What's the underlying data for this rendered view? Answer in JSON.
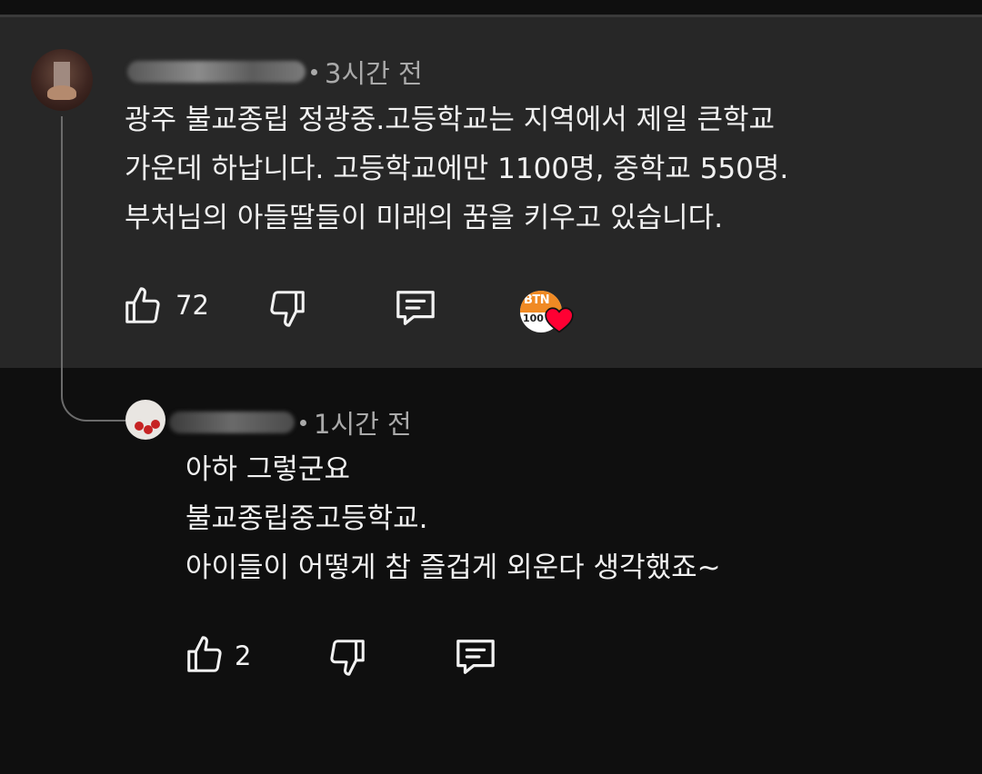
{
  "comment": {
    "time": "3시간 전",
    "lines": [
      "광주 불교종립 정광중.고등학교는 지역에서 제일 큰학교",
      "가운데 하납니다. 고등학교에만 1100명, 중학교 550명.",
      "부처님의 아들딸들이 미래의 꿈을 키우고 있습니다."
    ],
    "like_count": "72",
    "badge_text": "BTN",
    "badge_number": "100"
  },
  "reply": {
    "time": "1시간 전",
    "lines": [
      "아하 그렇군요",
      "불교종립중고등학교.",
      "아이들이 어떻게 참 즐겁게 외운다 생각했죠~"
    ],
    "like_count": "2"
  },
  "icons": {
    "like": "thumbs-up-icon",
    "dislike": "thumbs-down-icon",
    "reply": "comment-icon",
    "heart": "heart-icon"
  },
  "colors": {
    "background": "#0f0f0f",
    "highlight": "#272727",
    "text": "#f1f1f1",
    "meta": "#aaaaaa",
    "heart": "#ff0033"
  }
}
